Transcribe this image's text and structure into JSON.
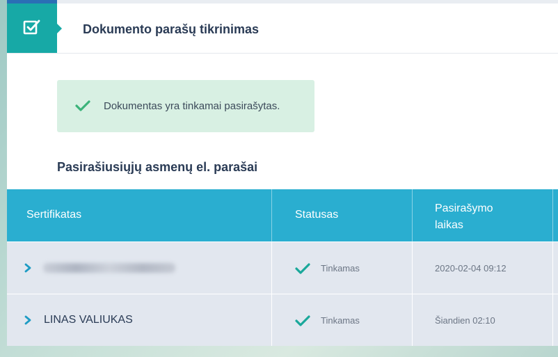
{
  "header": {
    "title": "Dokumento parašų tikrinimas",
    "icon": "checkbox-icon",
    "accent_color": "#17a9a6"
  },
  "alert": {
    "text": "Dokumentas yra tinkamai pasirašytas.",
    "icon": "check-icon",
    "background": "#d8f0e3"
  },
  "signatures": {
    "title": "Pasirašiusiųjų asmenų el. parašai",
    "columns": [
      "Sertifikatas",
      "Statusas",
      "Pasirašymo laikas"
    ],
    "header_color": "#2aaed0",
    "rows": [
      {
        "name": "",
        "name_blurred": true,
        "status": "Tinkamas",
        "time": "2020-02-04 09:12"
      },
      {
        "name": "LINAS VALIUKAS",
        "name_blurred": false,
        "status": "Tinkamas",
        "time": "Šiandien 02:10"
      }
    ]
  }
}
